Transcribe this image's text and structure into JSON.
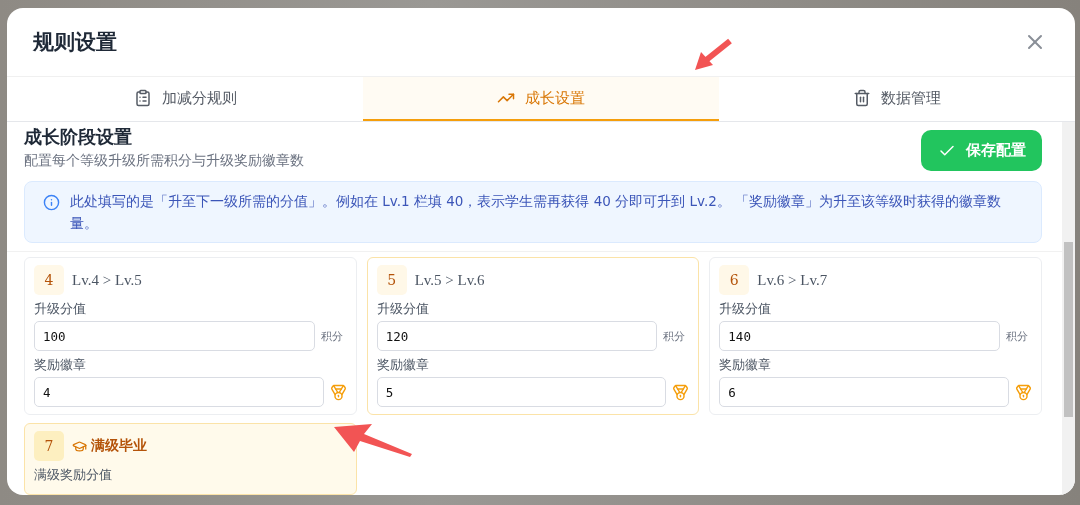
{
  "dialog": {
    "title": "规则设置"
  },
  "tabs": [
    {
      "label": "加减分规则",
      "selected": false
    },
    {
      "label": "成长设置",
      "selected": true
    },
    {
      "label": "数据管理",
      "selected": false
    }
  ],
  "section": {
    "title": "成长阶段设置",
    "subtitle": "配置每个等级升级所需积分与升级奖励徽章数",
    "save_button": "保存配置"
  },
  "notice": "此处填写的是「升至下一级所需的分值」。例如在 Lv.1 栏填 40，表示学生需再获得 40 分即可升到 Lv.2。 「奖励徽章」为升至该等级时获得的徽章数量。",
  "levels": [
    {
      "kind": "level",
      "number": "4",
      "title": "Lv.4 > Lv.5",
      "highlighted": false,
      "points_label": "升级分值",
      "points": "100",
      "points_unit": "积分",
      "badge_label": "奖励徽章",
      "badges": "4"
    },
    {
      "kind": "level",
      "number": "5",
      "title": "Lv.5 > Lv.6",
      "highlighted": true,
      "points_label": "升级分值",
      "points": "120",
      "points_unit": "积分",
      "badge_label": "奖励徽章",
      "badges": "5"
    },
    {
      "kind": "level",
      "number": "6",
      "title": "Lv.6 > Lv.7",
      "highlighted": false,
      "points_label": "升级分值",
      "points": "140",
      "points_unit": "积分",
      "badge_label": "奖励徽章",
      "badges": "6"
    },
    {
      "kind": "max",
      "number": "7",
      "title": "满级毕业",
      "points_label": "满级奖励分值"
    }
  ]
}
